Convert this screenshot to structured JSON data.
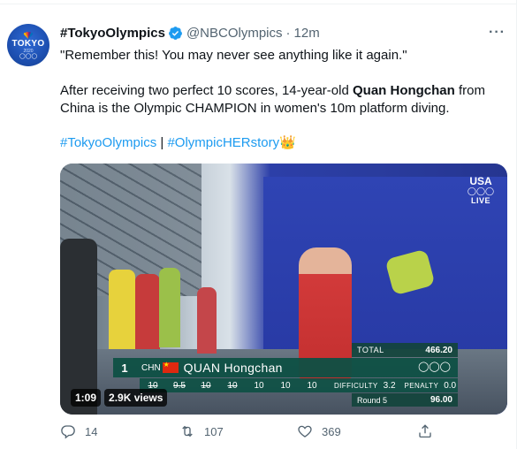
{
  "tweet": {
    "display_name": "#TokyoOlympics",
    "handle": "@NBCOlympics",
    "separator": "·",
    "time": "12m",
    "more_label": "···",
    "avatar": {
      "wordmark": "TOKYO",
      "year": "2020",
      "rings": "◯◯◯"
    },
    "text": {
      "line1": "\"Remember this! You may never see anything like it again.\"",
      "para2_before": "After receiving two perfect 10 scores, 14-year-old ",
      "para2_bold": "Quan Hongchan",
      "para2_after": " from China is the Olympic CHAMPION in women's 10m platform diving.",
      "hashtag1": "#TokyoOlympics",
      "pipe": " | ",
      "hashtag2": "#OlympicHERstory",
      "emoji": "👑"
    },
    "media": {
      "network_logo": "USA",
      "network_rings": "◯◯◯",
      "live_label": "LIVE",
      "duration": "1:09",
      "views": "2.9K views",
      "scoreboard": {
        "total_label": "TOTAL",
        "total_value": "466.20",
        "rank": "1",
        "nation": "CHN",
        "athlete_name": "QUAN Hongchan",
        "rings": "◯◯◯",
        "judges": [
          {
            "score": "10",
            "struck": true
          },
          {
            "score": "9.5",
            "struck": true
          },
          {
            "score": "10",
            "struck": true
          },
          {
            "score": "10",
            "struck": true
          },
          {
            "score": "10",
            "struck": false
          },
          {
            "score": "10",
            "struck": false
          },
          {
            "score": "10",
            "struck": false
          }
        ],
        "difficulty_label": "DIFFICULTY",
        "difficulty_value": "3.2",
        "penalty_label": "PENALTY",
        "penalty_value": "0.0",
        "round_label": "Round 5",
        "round_value": "96.00"
      }
    },
    "actions": {
      "replies": "14",
      "retweets": "107",
      "likes": "369"
    },
    "colors": {
      "link": "#1d9bf0",
      "secondary_text": "#536471",
      "verified": "#1d9bf0",
      "scoreboard": "#0e5044"
    }
  }
}
